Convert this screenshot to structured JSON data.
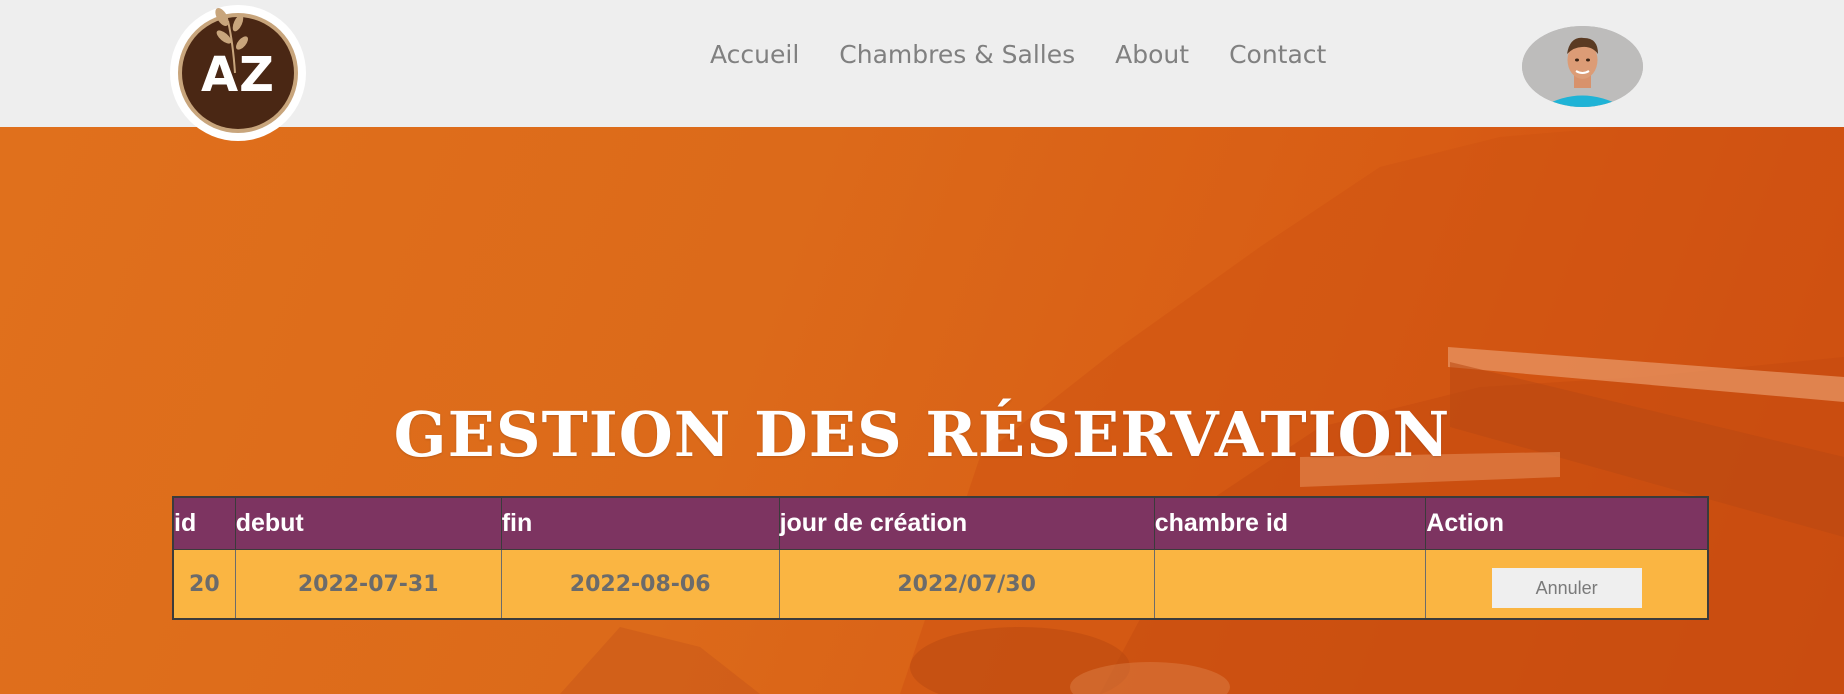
{
  "header": {
    "logo_text": "AZ",
    "nav": [
      {
        "label": "Accueil"
      },
      {
        "label": "Chambres & Salles"
      },
      {
        "label": "About"
      },
      {
        "label": "Contact"
      }
    ]
  },
  "main": {
    "title": "GESTION DES RÉSERVATION",
    "table": {
      "headers": [
        "id",
        "debut",
        "fin",
        "jour de création",
        "chambre id",
        "Action"
      ],
      "rows": [
        {
          "id": "20",
          "debut": "2022-07-31",
          "fin": "2022-08-06",
          "jour_creation": "2022/07/30",
          "chambre_id": "",
          "action_label": "Annuler"
        }
      ]
    }
  },
  "colors": {
    "header_bg": "#eeeeee",
    "hero_orange": "#d9621a",
    "table_header_bg": "#7d3461",
    "table_row_bg": "#fab542",
    "logo_brown": "#4a2714"
  }
}
